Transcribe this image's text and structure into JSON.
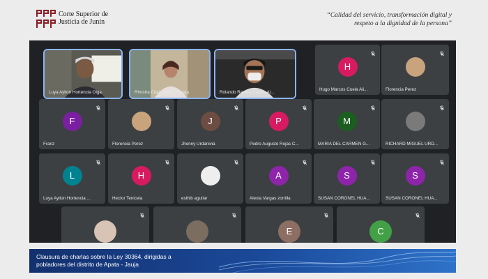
{
  "header": {
    "logo_text_line1": "Corte Superior de",
    "logo_text_line2": "Justicia de Junín",
    "slogan_line1": "“Calidad del servicio, transformación digital y",
    "slogan_line2": "respeto a la dignidad de la persona”"
  },
  "colors": {
    "grid_bg": "#202124",
    "tile_bg": "#3c4043",
    "accent": "#8ab4f8",
    "banner": "#1b4a9a"
  },
  "participants": [
    {
      "name": "Luya Aylion Hortencia Olga",
      "type": "video"
    },
    {
      "name": "Rhosha Claris Miren Zoniga",
      "type": "video"
    },
    {
      "name": "Rolando Ramiro Cotera Al...",
      "type": "video"
    },
    {
      "name": "Hugo Marcos Cuela Ali...",
      "initial": "H",
      "color": "#d81b60"
    },
    {
      "name": "Florencia Perez",
      "initial": "",
      "color": "#c9a37c"
    },
    {
      "name": "Franz",
      "initial": "F",
      "color": "#7b1fa2"
    },
    {
      "name": "Florencia Perez",
      "initial": "",
      "color": "#c9a37c"
    },
    {
      "name": "Jhonny Urdanivia",
      "initial": "J",
      "color": "#6d4c41"
    },
    {
      "name": "Pedro Augusto Rojas C...",
      "initial": "P",
      "color": "#d81b60"
    },
    {
      "name": "MARIA DEL CARMEN G...",
      "initial": "M",
      "color": "#1b5e20"
    },
    {
      "name": "RICHARD MIGUEL URD...",
      "initial": "",
      "color": "#7a7a7a"
    },
    {
      "name": "Luya Aylion Hortencia ...",
      "initial": "L",
      "color": "#00838f"
    },
    {
      "name": "Hector Teniceia",
      "initial": "H",
      "color": "#d81b60"
    },
    {
      "name": "esthib aguilar",
      "initial": "",
      "color": "#eeeeee"
    },
    {
      "name": "Alexia Vargas zorrilla",
      "initial": "A",
      "color": "#8e24aa"
    },
    {
      "name": "SUSAN CORONEL HUA...",
      "initial": "S",
      "color": "#8e24aa"
    },
    {
      "name": "SUSAN CORONEL HUA...",
      "initial": "S",
      "color": "#8e24aa"
    },
    {
      "name": "",
      "initial": "",
      "color": "#d8c3b5"
    },
    {
      "name": "",
      "initial": "",
      "color": "#7b6d5f"
    },
    {
      "name": "",
      "initial": "E",
      "color": "#8d6e63"
    },
    {
      "name": "",
      "initial": "C",
      "color": "#43a047"
    }
  ],
  "banner": {
    "line1": "Clausura de charlas sobre la Ley 30364, dirigidas a",
    "line2": "pobladores del distrito de Apata - Jauja"
  }
}
